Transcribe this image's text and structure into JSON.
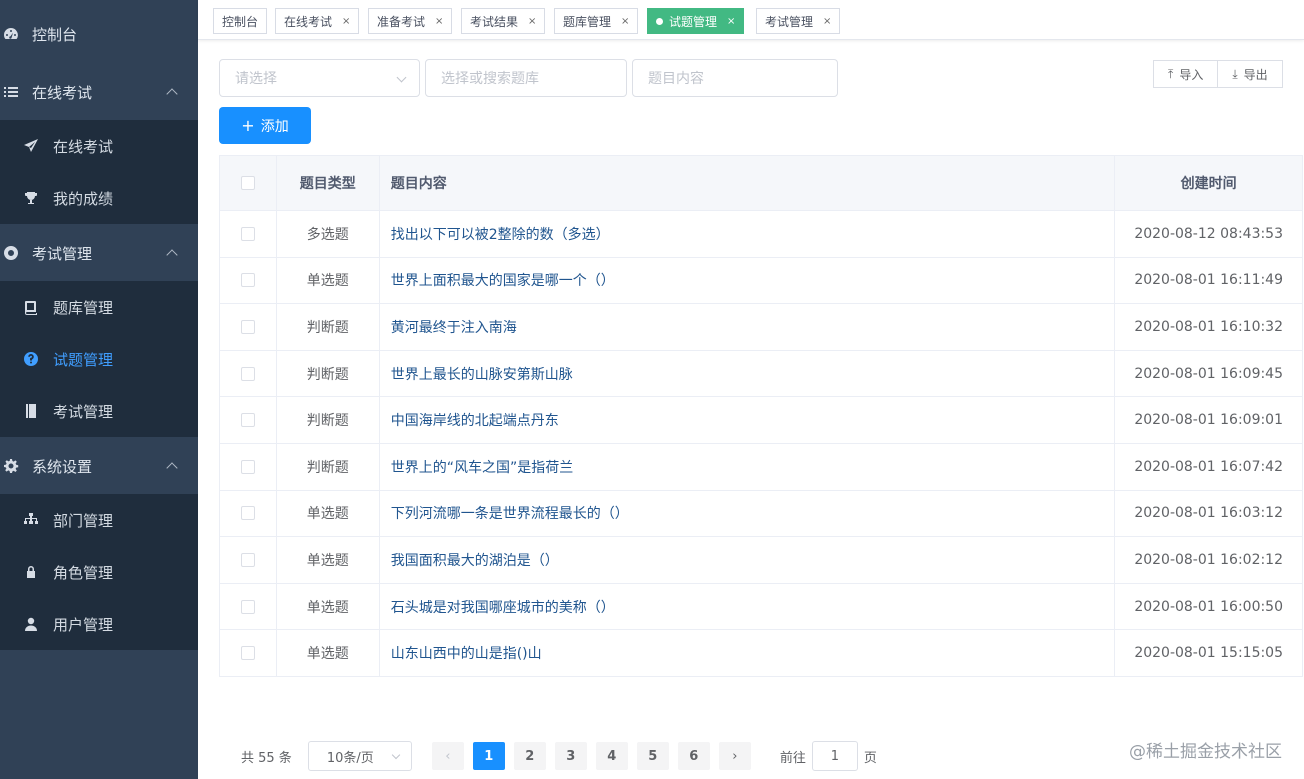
{
  "sidebar": {
    "dashboard": "控制台",
    "online_exam": "在线考试",
    "online_exam_sub": "在线考试",
    "my_scores": "我的成绩",
    "exam_mgmt": "考试管理",
    "bank_mgmt": "题库管理",
    "question_mgmt": "试题管理",
    "exam_mgmt_sub": "考试管理",
    "system": "系统设置",
    "dept": "部门管理",
    "role": "角色管理",
    "user": "用户管理"
  },
  "tags": [
    {
      "label": "控制台"
    },
    {
      "label": "在线考试"
    },
    {
      "label": "准备考试"
    },
    {
      "label": "考试结果"
    },
    {
      "label": "题库管理"
    },
    {
      "label": "试题管理"
    },
    {
      "label": "考试管理"
    }
  ],
  "tag_close": "×",
  "filters": {
    "type_placeholder": "请选择",
    "bank_placeholder": "选择或搜索题库",
    "content_placeholder": "题目内容"
  },
  "toolbar": {
    "import": "导入",
    "export": "导出",
    "add": "添加"
  },
  "table": {
    "headers": {
      "type": "题目类型",
      "content": "题目内容",
      "time": "创建时间"
    },
    "rows": [
      {
        "type": "多选题",
        "content": "找出以下可以被2整除的数（多选）",
        "time": "2020-08-12 08:43:53"
      },
      {
        "type": "单选题",
        "content": "世界上面积最大的国家是哪一个（）",
        "time": "2020-08-01 16:11:49"
      },
      {
        "type": "判断题",
        "content": "黄河最终于注入南海",
        "time": "2020-08-01 16:10:32"
      },
      {
        "type": "判断题",
        "content": "世界上最长的山脉安第斯山脉",
        "time": "2020-08-01 16:09:45"
      },
      {
        "type": "判断题",
        "content": "中国海岸线的北起端点丹东",
        "time": "2020-08-01 16:09:01"
      },
      {
        "type": "判断题",
        "content": "世界上的“风车之国”是指荷兰",
        "time": "2020-08-01 16:07:42"
      },
      {
        "type": "单选题",
        "content": "下列河流哪一条是世界流程最长的（）",
        "time": "2020-08-01 16:03:12"
      },
      {
        "type": "单选题",
        "content": "我国面积最大的湖泊是（）",
        "time": "2020-08-01 16:02:12"
      },
      {
        "type": "单选题",
        "content": "石头城是对我国哪座城市的美称（）",
        "time": "2020-08-01 16:00:50"
      },
      {
        "type": "单选题",
        "content": "山东山西中的山是指()山",
        "time": "2020-08-01 15:15:05"
      }
    ]
  },
  "pagination": {
    "total": "共 55 条",
    "page_size": "10条/页",
    "pages": [
      "1",
      "2",
      "3",
      "4",
      "5",
      "6"
    ],
    "prev": "‹",
    "next": "›",
    "goto_prefix": "前往",
    "goto_value": "1",
    "goto_suffix": "页"
  },
  "watermark": "@稀土掘金技术社区"
}
